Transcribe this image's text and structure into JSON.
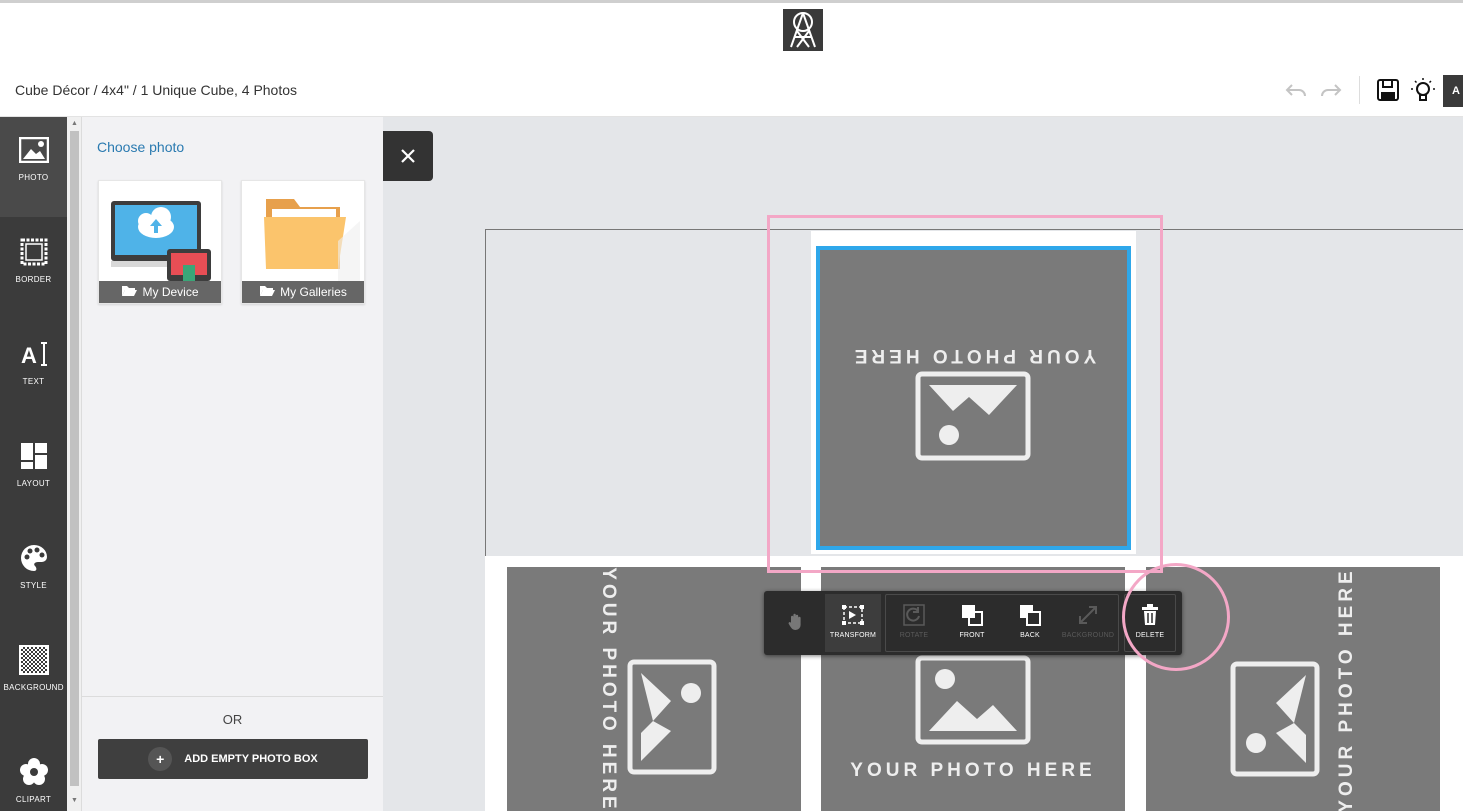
{
  "header": {
    "breadcrumb": "Cube Décor / 4x4\" / 1 Unique Cube, 4 Photos",
    "account_label": "A"
  },
  "rail": {
    "items": [
      {
        "label": "PHOTO"
      },
      {
        "label": "BORDER"
      },
      {
        "label": "TEXT"
      },
      {
        "label": "LAYOUT"
      },
      {
        "label": "STYLE"
      },
      {
        "label": "BACKGROUND"
      },
      {
        "label": "CLIPART"
      }
    ]
  },
  "panel": {
    "choose_label": "Choose photo",
    "sources": [
      {
        "label": "My Device"
      },
      {
        "label": "My Galleries"
      }
    ],
    "or_label": "OR",
    "add_button": "ADD EMPTY PHOTO BOX"
  },
  "canvas": {
    "placeholder_text": "YOUR PHOTO HERE"
  },
  "toolbar": {
    "tools": [
      {
        "label": "TRANSFORM"
      },
      {
        "label": "ROTATE"
      },
      {
        "label": "FRONT"
      },
      {
        "label": "BACK"
      },
      {
        "label": "BACKGROUND"
      },
      {
        "label": "DELETE"
      }
    ]
  },
  "colors": {
    "selection": "#2ea7ea",
    "annotation": "#f3a7c6",
    "rail": "#3b3b3b",
    "link": "#2a7ab0"
  }
}
